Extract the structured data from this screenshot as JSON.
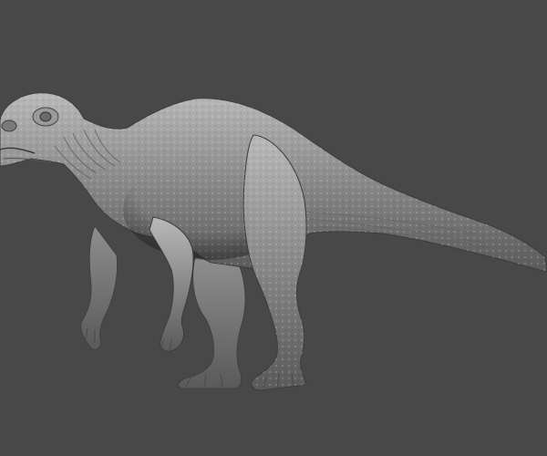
{
  "scene": {
    "subject": "sculpted-dinosaur-model",
    "background_color": "#484848",
    "model_base_color": "#8e8e8e",
    "model_highlight_color": "#b9b9b9",
    "model_shadow_color": "#5a5a5a"
  }
}
